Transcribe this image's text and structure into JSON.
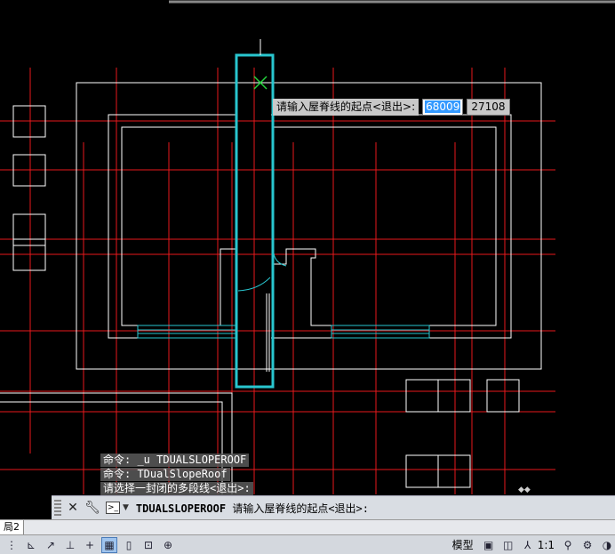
{
  "canvas": {
    "background": "#000000",
    "grid_color": "#e8191c",
    "wall_color": "#ffffff",
    "selection_color": "#29c6cf",
    "cursor_color": "#25d43c"
  },
  "dynamic_input": {
    "prompt": "请输入屋脊线的起点<退出>:",
    "x_value": "68009",
    "y_value": "27108"
  },
  "history": [
    "命令: _u TDUALSLOPEROOF",
    "命令: TDualSlopeRoof",
    "请选择一封闭的多段线<退出>:"
  ],
  "command_line": {
    "close_icon": "close-icon",
    "settings_icon": "wrench-icon",
    "command": "TDUALSLOPEROOF",
    "prompt": "请输入屋脊线的起点<退出>:"
  },
  "layout_tab": "局2",
  "statusbar": {
    "buttons": [
      "snap-icon",
      "ortho-icon",
      "polar-icon",
      "osnap-icon",
      "otrack-icon",
      "grid-icon",
      "dyn-icon",
      "lwt-icon",
      "qp-icon"
    ],
    "model_label": "模型",
    "scale": "1:1"
  }
}
